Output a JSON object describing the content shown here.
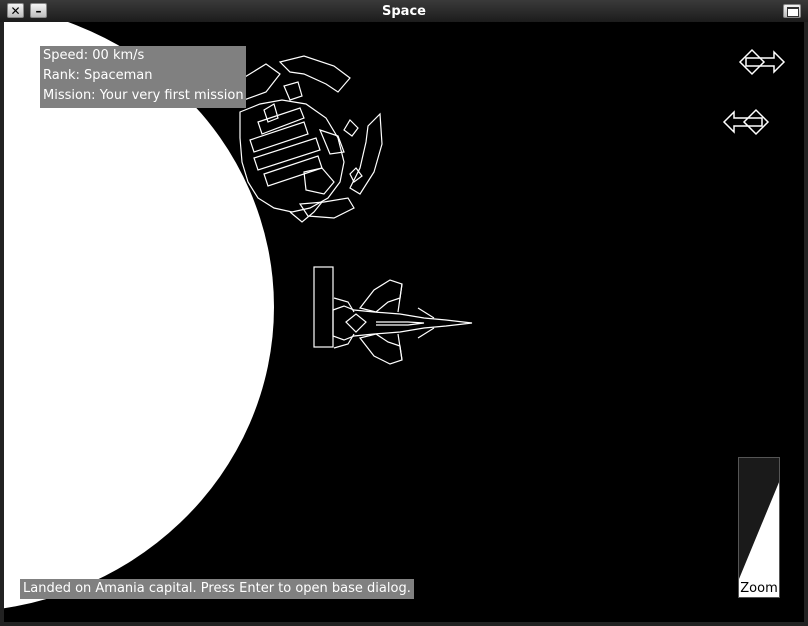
{
  "window": {
    "title": "Space",
    "close_label": "✕",
    "minimize_label": "–"
  },
  "hud": {
    "speed": "Speed: 00 km/s",
    "rank": "Rank: Spaceman",
    "mission": "Mission: Your very first mission"
  },
  "status_message": "Landed on Amania capital. Press Enter to open base dialog.",
  "zoom": {
    "label": "Zoom",
    "level": 0.8
  },
  "colors": {
    "space": "#000000",
    "planet": "#ffffff",
    "hud_panel": "#808080",
    "outline": "#ffffff"
  },
  "icons": {
    "top_indicator": "arrow-right-diamond-icon",
    "bottom_indicator": "arrow-left-diamond-icon"
  }
}
